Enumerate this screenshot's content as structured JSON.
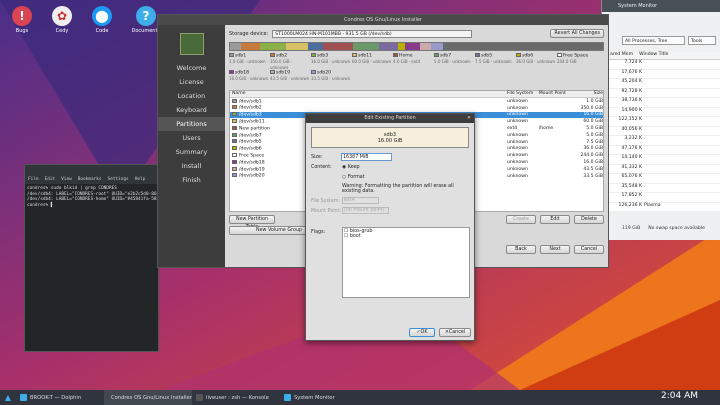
{
  "desktop": {
    "icons": [
      {
        "label": "Bugs",
        "glyph": "!",
        "color": "#da4453"
      },
      {
        "label": "Cedy",
        "glyph": "✿",
        "color": "#eeeeee"
      },
      {
        "label": "Code",
        "glyph": "⬤",
        "color": "#1d99f3"
      },
      {
        "label": "Documenta",
        "glyph": "?",
        "color": "#3daee9"
      }
    ]
  },
  "sysmon": {
    "title": "System Monitor",
    "filter": "All Processes, Tree",
    "tools": "Tools",
    "columns": [
      "ared Mem",
      "Window Title"
    ],
    "rows": [
      [
        "7,724 K",
        ""
      ],
      [
        "17,676 K",
        ""
      ],
      [
        "45,204 K",
        ""
      ],
      [
        "92,728 K",
        ""
      ],
      [
        "38,736 K",
        ""
      ],
      [
        "14,900 K",
        ""
      ],
      [
        "122,152 K",
        ""
      ],
      [
        "40,056 K",
        ""
      ],
      [
        "3,232 K",
        ""
      ],
      [
        "47,176 K",
        ""
      ],
      [
        "14,140 K",
        ""
      ],
      [
        "41,332 K",
        ""
      ],
      [
        "65,076 K",
        ""
      ],
      [
        "35,548 K",
        ""
      ],
      [
        "17,852 K",
        ""
      ],
      [
        "126,236 K",
        "Plasma"
      ]
    ],
    "footer": [
      "119 GiB",
      "No swap space available"
    ]
  },
  "installer": {
    "title": "Condres OS Gnu/Linux Installer",
    "nav": [
      "Welcome",
      "License",
      "Location",
      "Keyboard",
      "Partitions",
      "Users",
      "Summary",
      "Install",
      "Finish"
    ],
    "active_nav": "Partitions",
    "storage_label": "Storage device:",
    "storage_value": "ST1000LM024 HN-M101MBB - 931.5 GB (/dev/sdb)",
    "revert_label": "Revert All Changes",
    "bar": [
      {
        "color": "#9a9a9a",
        "frac": 0.03
      },
      {
        "color": "#c87a3c",
        "frac": 0.05
      },
      {
        "color": "#8bb04a",
        "frac": 0.07
      },
      {
        "color": "#d8c066",
        "frac": 0.06
      },
      {
        "color": "#4b6e9e",
        "frac": 0.04
      },
      {
        "color": "#a05050",
        "frac": 0.08
      },
      {
        "color": "#6a9a6a",
        "frac": 0.07
      },
      {
        "color": "#7a6aa0",
        "frac": 0.05
      },
      {
        "color": "#b8b000",
        "frac": 0.02
      },
      {
        "color": "#8a3a8a",
        "frac": 0.04
      },
      {
        "color": "#caa",
        "frac": 0.03
      },
      {
        "color": "#99c",
        "frac": 0.03
      },
      {
        "color": "#6a6a6a",
        "frac": 0.43
      }
    ],
    "legend": [
      {
        "name": "sdb1",
        "size": "1.0 GiB · unknown",
        "color": "#9a9a9a"
      },
      {
        "name": "sdb2",
        "size": "350.0 GiB · unknown",
        "color": "#c87a3c"
      },
      {
        "name": "sdb3",
        "size": "16.0 GiB · unknown",
        "color": "#8bb04a"
      },
      {
        "name": "sdb11",
        "size": "60.0 GiB · unknown",
        "color": "#d8c066"
      },
      {
        "name": "Home",
        "size": "4.0 GiB · ext4",
        "color": "#a05050"
      },
      {
        "name": "sdb7",
        "size": "5.0 GiB · unknown",
        "color": "#6a9a6a"
      },
      {
        "name": "sdb5",
        "size": "7.5 GiB · unknown",
        "color": "#7a6aa0"
      },
      {
        "name": "sdb6",
        "size": "36.0 GiB · unknown",
        "color": "#b8b000"
      },
      {
        "name": "Free Space",
        "size": "244.0 GiB",
        "color": "#ffffff"
      },
      {
        "name": "sdb18",
        "size": "16.0 GiB · unknown",
        "color": "#8a3a8a"
      },
      {
        "name": "sdb19",
        "size": "43.5 GiB · unknown",
        "color": "#caa"
      },
      {
        "name": "sdb20",
        "size": "33.5 GiB · unknown",
        "color": "#99c"
      }
    ],
    "table_headers": [
      "Name",
      "File System",
      "Mount Point",
      "Size"
    ],
    "rows": [
      {
        "name": "/dev/sdb1",
        "fs": "unknown",
        "mount": "",
        "size": "1.0 GiB",
        "color": "#9a9a9a"
      },
      {
        "name": "/dev/sdb2",
        "fs": "unknown",
        "mount": "",
        "size": "350.0 GiB",
        "color": "#c87a3c"
      },
      {
        "name": "/dev/sdb3",
        "fs": "unknown",
        "mount": "",
        "size": "16.0 GiB",
        "color": "#8bb04a",
        "selected": true
      },
      {
        "name": "/dev/sdb11",
        "fs": "unknown",
        "mount": "",
        "size": "60.0 GiB",
        "color": "#d8c066"
      },
      {
        "name": "New partition",
        "fs": "ext4",
        "mount": "/home",
        "size": "5.0 GiB",
        "color": "#a05050"
      },
      {
        "name": "/dev/sdb7",
        "fs": "unknown",
        "mount": "",
        "size": "5.0 GiB",
        "color": "#6a9a6a"
      },
      {
        "name": "/dev/sdb5",
        "fs": "unknown",
        "mount": "",
        "size": "7.5 GiB",
        "color": "#7a6aa0"
      },
      {
        "name": "/dev/sdb6",
        "fs": "unknown",
        "mount": "",
        "size": "36.0 GiB",
        "color": "#b8b000"
      },
      {
        "name": "Free Space",
        "fs": "unknown",
        "mount": "",
        "size": "244.0 GiB",
        "color": "#ffffff"
      },
      {
        "name": "/dev/sdb18",
        "fs": "unknown",
        "mount": "",
        "size": "16.0 GiB",
        "color": "#8a3a8a"
      },
      {
        "name": "/dev/sdb19",
        "fs": "unknown",
        "mount": "",
        "size": "43.5 GiB",
        "color": "#caa"
      },
      {
        "name": "/dev/sdb20",
        "fs": "unknown",
        "mount": "",
        "size": "33.5 GiB",
        "color": "#99c"
      }
    ],
    "new_table": "New Partition Table",
    "new_vg": "New Volume Group",
    "create": "Create",
    "edit": "Edit",
    "delete": "Delete",
    "back": "Back",
    "next": "Next",
    "cancel": "Cancel"
  },
  "dialog": {
    "title": "Edit Existing Partition",
    "pv_name": "sdb3",
    "pv_size": "16.00 GiB",
    "size_label": "Size:",
    "size_value": "16387 MiB",
    "content_label": "Content:",
    "keep": "Keep",
    "format": "Format",
    "warning": "Warning: Formatting the partition will erase all existing data.",
    "fs_label": "File System:",
    "fs_value": "ext4",
    "mount_label": "Mount Point:",
    "mount_value": "(no mount point)",
    "flags_label": "Flags:",
    "flags": [
      "bios-grub",
      "boot"
    ],
    "ok": "OK",
    "cancel": "Cancel"
  },
  "terminal": {
    "menu": [
      "File",
      "Edit",
      "View",
      "Bookmarks",
      "Settings",
      "Help"
    ],
    "lines": [
      "condres% sudo blkid | grep CONDRES",
      "/dev/sdb4: LABEL=\"CONDRES-root\" UUID=\"e2b2c5d0-868c",
      "/dev/sdb4: LABEL=\"CONDRES-home\" UUID=\"#45841fa-585C",
      "condres% ▌"
    ]
  },
  "taskbar": {
    "tasks": [
      {
        "label": "BROOK-T — Dolphin",
        "color": "#3daee9"
      },
      {
        "label": "Condres OS Gnu/Linux Installer",
        "color": "#6a9a3a",
        "active": true
      },
      {
        "label": "liveuser : zsh — Konsole",
        "color": "#555555"
      },
      {
        "label": "System Monitor",
        "color": "#3daee9"
      }
    ],
    "clock": "2:04 AM"
  }
}
